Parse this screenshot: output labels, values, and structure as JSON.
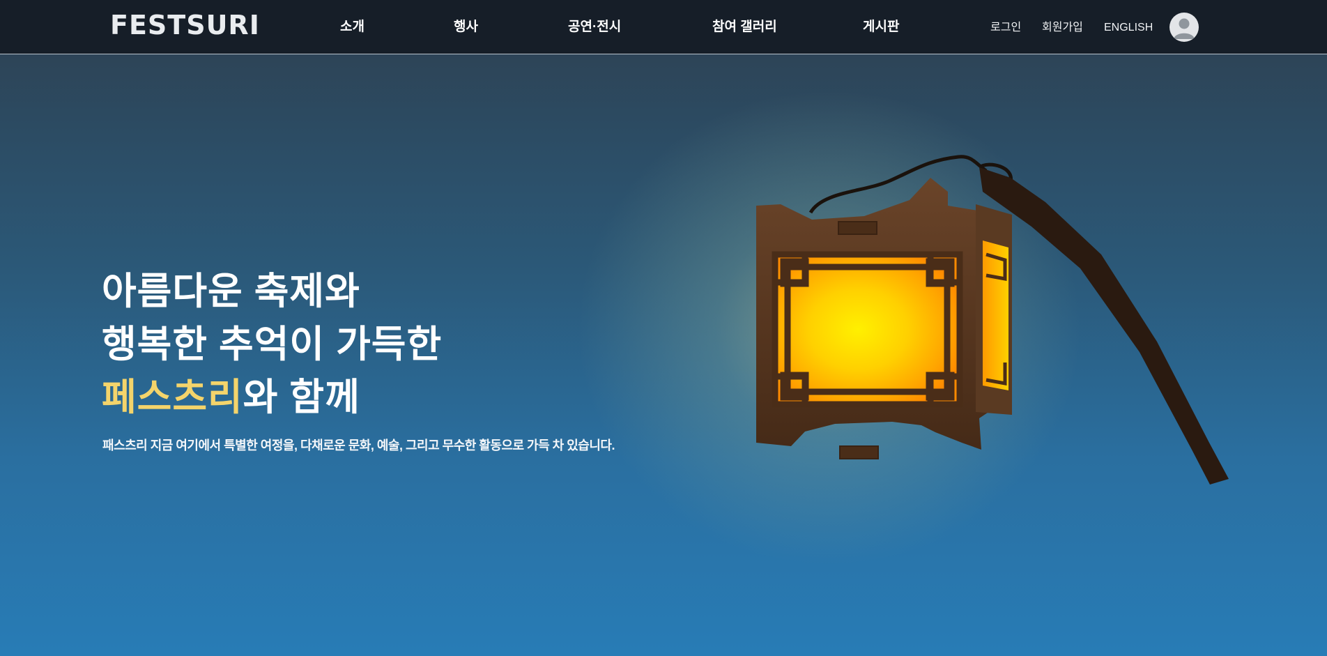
{
  "header": {
    "logo": "FESTSURI",
    "nav": [
      {
        "label": "소개"
      },
      {
        "label": "행사"
      },
      {
        "label": "공연·전시"
      },
      {
        "label": "참여 갤러리"
      },
      {
        "label": "게시판"
      }
    ],
    "util": {
      "login": "로그인",
      "signup": "회원가입",
      "language": "ENGLISH"
    },
    "avatar_icon": "user-avatar-icon"
  },
  "hero": {
    "line1": "아름다운 축제와",
    "line2": "행복한 추억이 가득한",
    "line3_highlight": "페스츠리",
    "line3_rest": "와 함께",
    "subtitle": "패스츠리 지금 여기에서 특별한 여정을, 다채로운 문화, 예술, 그리고 무수한 활동으로 가득 차 있습니다.",
    "illustration": "lantern-illustration"
  },
  "colors": {
    "header_bg": "#161e28",
    "highlight": "#f4d46b",
    "lantern_glow": "#ffc21a"
  }
}
